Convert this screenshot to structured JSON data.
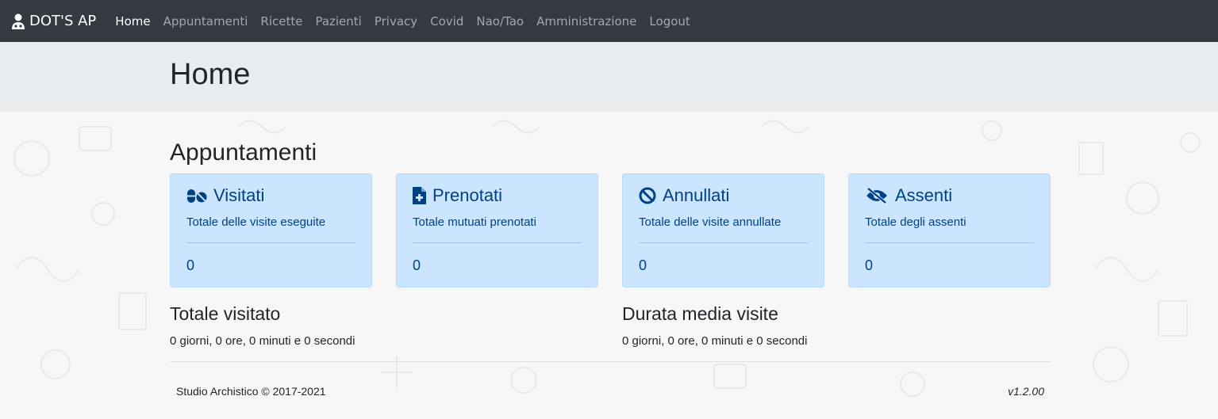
{
  "navbar": {
    "brand": "DOT'S AP",
    "brand_icon": "user-doctor-icon",
    "items": [
      {
        "label": "Home",
        "active": true
      },
      {
        "label": "Appuntamenti",
        "active": false
      },
      {
        "label": "Ricette",
        "active": false
      },
      {
        "label": "Pazienti",
        "active": false
      },
      {
        "label": "Privacy",
        "active": false
      },
      {
        "label": "Covid",
        "active": false
      },
      {
        "label": "Nao/Tao",
        "active": false
      },
      {
        "label": "Amministrazione",
        "active": false
      },
      {
        "label": "Logout",
        "active": false
      }
    ]
  },
  "page": {
    "title": "Home"
  },
  "appointments": {
    "title": "Appuntamenti",
    "cards": [
      {
        "title": "Visitati",
        "icon": "pills-icon",
        "description": "Totale delle visite eseguite",
        "value": "0"
      },
      {
        "title": "Prenotati",
        "icon": "file-medical-icon",
        "description": "Totale mutuati prenotati",
        "value": "0"
      },
      {
        "title": "Annullati",
        "icon": "ban-icon",
        "description": "Totale delle visite annullate",
        "value": "0"
      },
      {
        "title": "Assenti",
        "icon": "eye-slash-icon",
        "description": "Totale degli assenti",
        "value": "0"
      }
    ]
  },
  "stats": {
    "total": {
      "title": "Totale visitato",
      "value": "0 giorni, 0 ore, 0 minuti e 0 secondi"
    },
    "average": {
      "title": "Durata media visite",
      "value": "0 giorni, 0 ore, 0 minuti e 0 secondi"
    }
  },
  "footer": {
    "copyright": "Studio Archistico © 2017-2021",
    "version": "v1.2.00"
  },
  "colors": {
    "navbar_bg": "#343a40",
    "card_bg": "#cce5ff",
    "card_text": "#004085",
    "jumbotron_bg": "#e9ecef"
  }
}
